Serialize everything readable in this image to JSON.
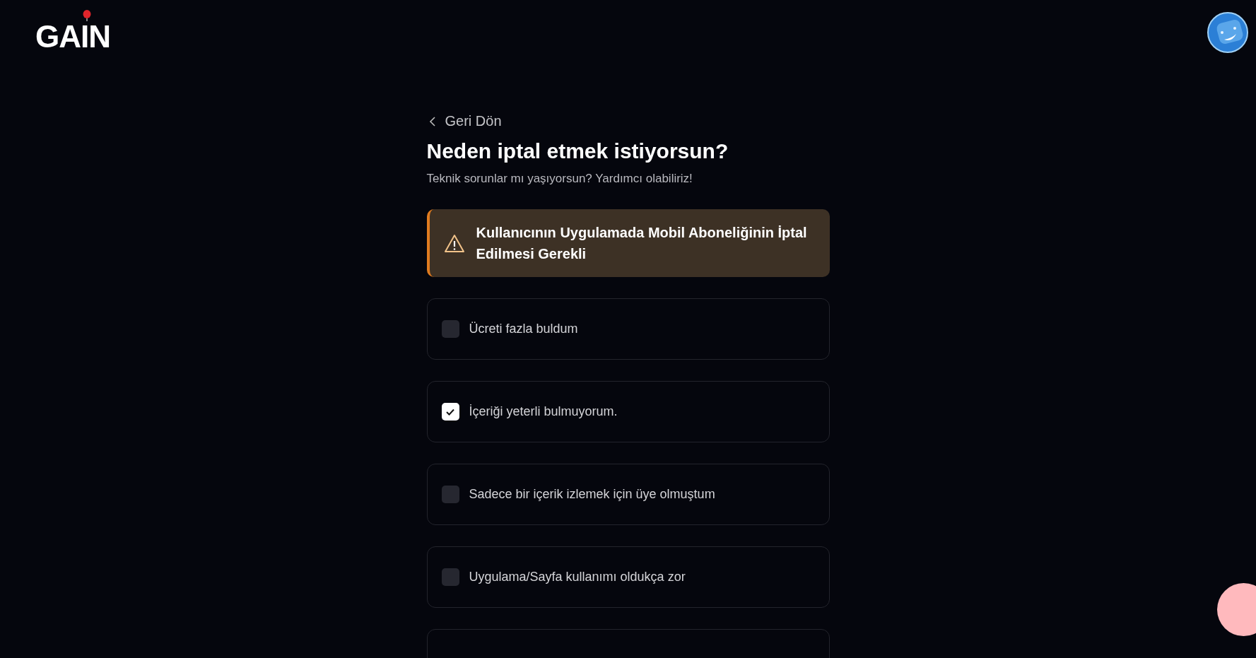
{
  "header": {
    "logo": "GAIN"
  },
  "back_link": {
    "label": "Geri Dön"
  },
  "title": "Neden iptal etmek istiyorsun?",
  "subtitle": "Teknik sorunlar mı yaşıyorsun? Yardımcı olabiliriz!",
  "alert": {
    "kind": "warning",
    "text": "Kullanıcının Uygulamada Mobil Aboneliğinin İptal Edilmesi Gerekli"
  },
  "options": [
    {
      "label": "Ücreti fazla buldum",
      "checked": false
    },
    {
      "label": "İçeriği yeterli bulmuyorum.",
      "checked": true
    },
    {
      "label": "Sadece bir içerik izlemek için üye olmuştum",
      "checked": false
    },
    {
      "label": "Uygulama/Sayfa kullanımı oldukça zor",
      "checked": false
    }
  ]
}
